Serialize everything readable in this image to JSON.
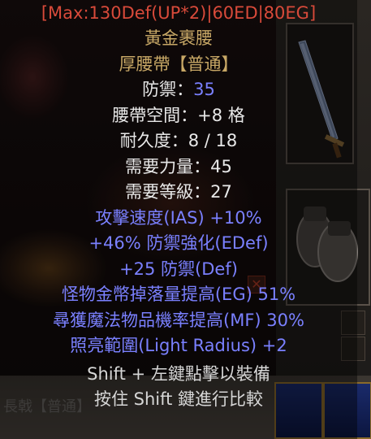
{
  "header_line": "[Max:130Def(UP*2)|60ED|80EG]",
  "item": {
    "name": "黃金裹腰",
    "type": "厚腰帶【普通】",
    "defense_label": "防禦：",
    "defense_value": "35",
    "belt_slots": "腰帶空間：+8 格",
    "durability": "耐久度：8 / 18",
    "req_strength": "需要力量：45",
    "req_level": "需要等級：27"
  },
  "magic_properties": [
    "攻擊速度(IAS) +10%",
    "+46% 防禦強化(EDef)",
    "+25 防禦(Def)",
    "怪物金幣掉落量提高(EG) 51%",
    "尋獲魔法物品機率提高(MF) 30%",
    "照亮範圍(Light Radius) +2"
  ],
  "hints": [
    "Shift + 左鍵點擊以裝備",
    "按住 Shift 鍵進行比較"
  ],
  "background": {
    "obscured_item_label": "長戟【普通】"
  },
  "colors": {
    "header_red": "#d84a3a",
    "unique_gold": "#c8a866",
    "normal_white": "#e8e8e8",
    "magic_blue": "#7a80ff"
  },
  "icons": {
    "sword": "sword-icon",
    "gloves": "gloves-icon",
    "close_x": "close-x-icon"
  }
}
